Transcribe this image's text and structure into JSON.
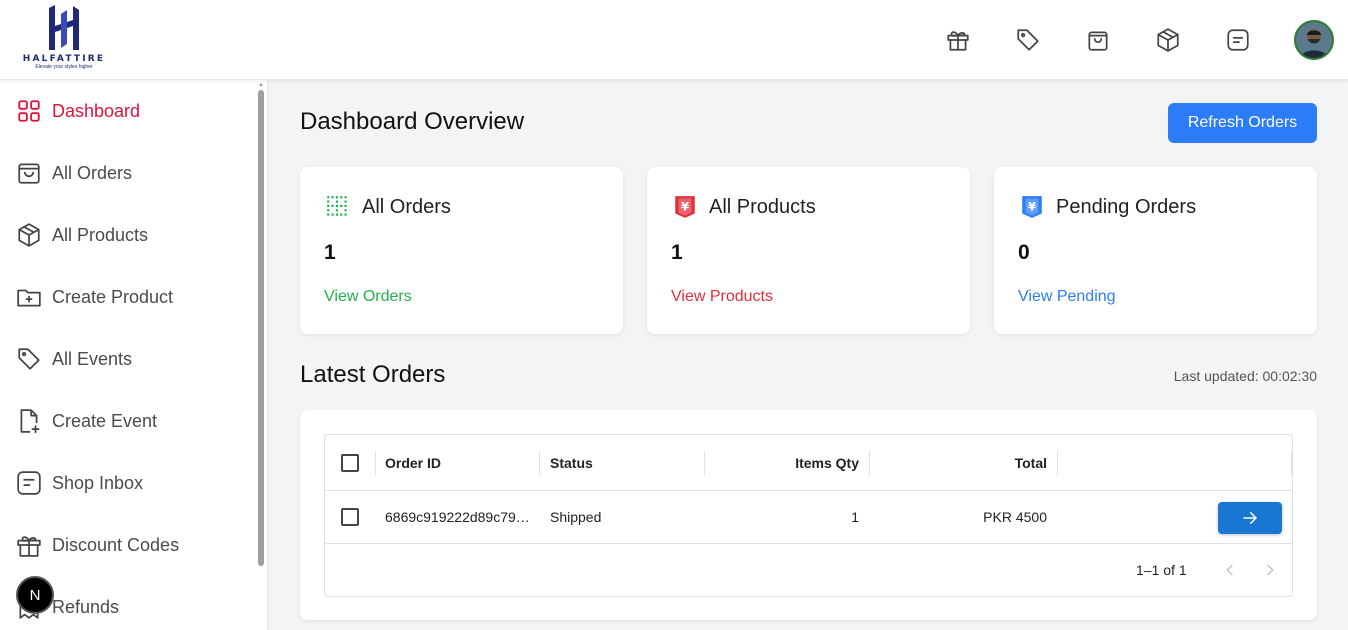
{
  "brand": {
    "name": "HALFATTIRE",
    "tagline": "Elevate your styles higher"
  },
  "header": {
    "icons": [
      "gift-icon",
      "tag-icon",
      "shopping-bag-icon",
      "package-icon",
      "message-icon"
    ],
    "avatar": "user-avatar"
  },
  "sidebar": {
    "items": [
      {
        "label": "Dashboard",
        "icon": "dashboard-grid-icon",
        "active": true
      },
      {
        "label": "All Orders",
        "icon": "shopping-bag-icon"
      },
      {
        "label": "All Products",
        "icon": "package-icon"
      },
      {
        "label": "Create Product",
        "icon": "folder-plus-icon"
      },
      {
        "label": "All Events",
        "icon": "tag-icon"
      },
      {
        "label": "Create Event",
        "icon": "file-plus-icon"
      },
      {
        "label": "Shop Inbox",
        "icon": "message-icon"
      },
      {
        "label": "Discount Codes",
        "icon": "gift-icon"
      },
      {
        "label": "Refunds",
        "icon": "receipt-icon"
      }
    ],
    "badge": "N"
  },
  "main": {
    "title": "Dashboard Overview",
    "refresh_label": "Refresh Orders",
    "cards": [
      {
        "title": "All Orders",
        "count": "1",
        "link": "View Orders",
        "color": "#22b14c",
        "icon": "dotted-grid-icon"
      },
      {
        "title": "All Products",
        "count": "1",
        "link": "View Products",
        "color": "#e0313b",
        "icon": "yen-shield-icon"
      },
      {
        "title": "Pending Orders",
        "count": "0",
        "link": "View Pending",
        "color": "#2b7cf6",
        "icon": "yen-shield-icon"
      }
    ],
    "latest_title": "Latest Orders",
    "last_updated": "Last updated: 00:02:30",
    "table": {
      "columns": [
        "Order ID",
        "Status",
        "Items Qty",
        "Total"
      ],
      "rows": [
        {
          "order_id": "6869c919222d89c79…",
          "status": "Shipped",
          "qty": "1",
          "total": "PKR 4500"
        }
      ],
      "pagination": "1–1 of 1"
    }
  }
}
